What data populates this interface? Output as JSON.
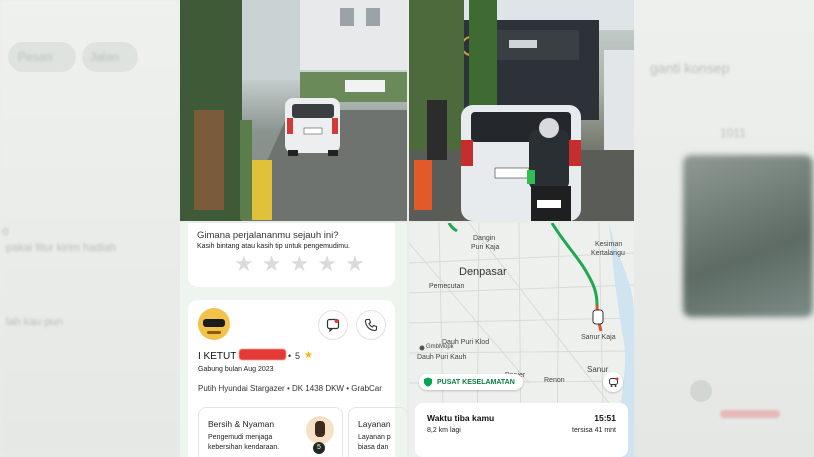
{
  "background": {
    "left_texts": [
      "Pesan",
      "Jalan",
      "o",
      "pakai fitur kirim hadiah",
      "lah kau pun"
    ],
    "right_texts": [
      "ganti konsep",
      "1011"
    ]
  },
  "rating_card": {
    "question": "Gimana perjalananmu sejauh ini?",
    "subtitle": "Kasih bintang atau kasih tip untuk pengemudimu.",
    "stars": 5
  },
  "driver": {
    "name": "I KETUT",
    "rating": "5",
    "joined": "Gabung bulan Aug 2023",
    "vehicle": "Putih Hyundai Stargazer • DK 1438 DKW • GrabCar",
    "compliment1_title": "Bersih & Nyaman",
    "compliment1_desc_line1": "Pengemudi menjaga",
    "compliment1_desc_line2": "kebersihan kendaraan.",
    "compliment1_count": "5",
    "compliment2_title": "Layanan",
    "compliment2_desc_line1": "Layanan p",
    "compliment2_desc_line2": "biasa dan"
  },
  "map": {
    "labels": {
      "dangin": "Dangin",
      "puri_kaja": "Puri Kaja",
      "kesiman": "Kesiman",
      "kertalangu": "Kertalangu",
      "denpasar": "Denpasar",
      "pemecutan": "Pemecutan",
      "dauh_puri_klod": "Dauh Puri Klod",
      "gmbmopk": "GmbMopk",
      "dauh_puri_kauh": "Dauh Puri Kauh",
      "panjer": "Panjer",
      "renon": "Renon",
      "sanur_kaja": "Sanur Kaja",
      "sanur": "Sanur"
    },
    "safety_label": "PUSAT KESELAMATAN",
    "arrival_label": "Waktu tiba kamu",
    "arrival_time": "15:51",
    "distance": "8,2 km lagi",
    "remaining": "tersisa 41 mnt"
  },
  "colors": {
    "accent": "#00a651",
    "star_active": "#f5b800",
    "redaction": "#e53935"
  }
}
